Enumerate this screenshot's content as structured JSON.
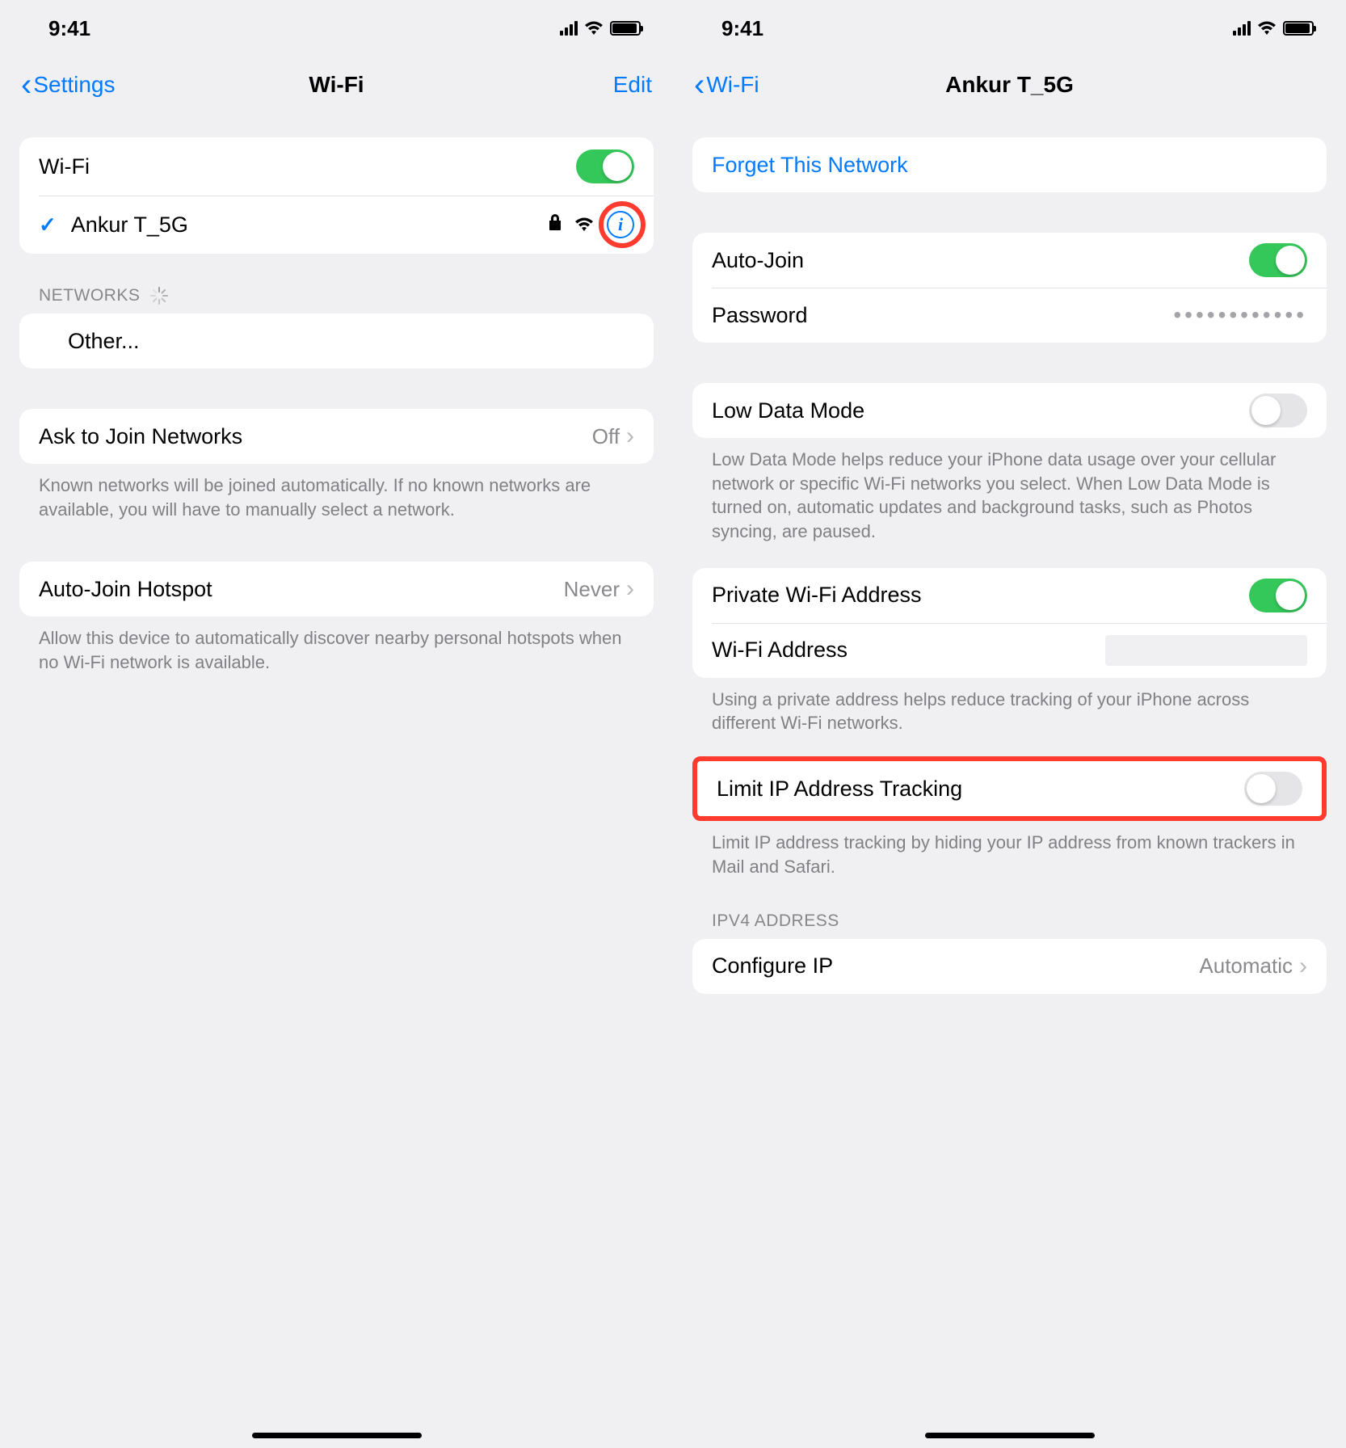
{
  "left": {
    "status": {
      "time": "9:41"
    },
    "nav": {
      "back": "Settings",
      "title": "Wi-Fi",
      "edit": "Edit"
    },
    "wifi_row": {
      "label": "Wi-Fi",
      "on": true
    },
    "current_network": {
      "name": "Ankur T_5G"
    },
    "networks_header": "NETWORKS",
    "other": "Other...",
    "ask_join": {
      "label": "Ask to Join Networks",
      "value": "Off"
    },
    "ask_join_footer": "Known networks will be joined automatically. If no known networks are available, you will have to manually select a network.",
    "auto_hotspot": {
      "label": "Auto-Join Hotspot",
      "value": "Never"
    },
    "auto_hotspot_footer": "Allow this device to automatically discover nearby personal hotspots when no Wi-Fi network is available."
  },
  "right": {
    "status": {
      "time": "9:41"
    },
    "nav": {
      "back": "Wi-Fi",
      "title": "Ankur T_5G"
    },
    "forget": "Forget This Network",
    "auto_join": {
      "label": "Auto-Join",
      "on": true
    },
    "password": {
      "label": "Password",
      "value": "••••••••••••"
    },
    "low_data": {
      "label": "Low Data Mode",
      "on": false
    },
    "low_data_footer": "Low Data Mode helps reduce your iPhone data usage over your cellular network or specific Wi-Fi networks you select. When Low Data Mode is turned on, automatic updates and background tasks, such as Photos syncing, are paused.",
    "private_addr": {
      "label": "Private Wi-Fi Address",
      "on": true
    },
    "wifi_addr": {
      "label": "Wi-Fi Address"
    },
    "private_footer": "Using a private address helps reduce tracking of your iPhone across different Wi-Fi networks.",
    "limit_ip": {
      "label": "Limit IP Address Tracking",
      "on": false
    },
    "limit_ip_footer": "Limit IP address tracking by hiding your IP address from known trackers in Mail and Safari.",
    "ipv4_header": "IPV4 ADDRESS",
    "configure_ip": {
      "label": "Configure IP",
      "value": "Automatic"
    }
  }
}
